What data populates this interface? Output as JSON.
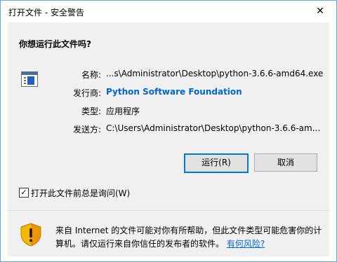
{
  "window": {
    "title": "打开文件 - 安全警告",
    "close_glyph": "✕"
  },
  "dialog": {
    "question": "你想运行此文件吗?",
    "file_icon": "exe-file-icon",
    "fields": [
      {
        "label": "名称:",
        "value": "...s\\Administrator\\Desktop\\python-3.6.6-amd64.exe"
      },
      {
        "label": "发行商:",
        "value": "Python Software Foundation"
      },
      {
        "label": "类型:",
        "value": "应用程序"
      },
      {
        "label": "发送方:",
        "value": "C:\\Users\\Administrator\\Desktop\\python-3.6.6-am..."
      }
    ],
    "run_button": "运行(R)",
    "cancel_button": "取消",
    "always_ask_checkbox": {
      "label": "打开此文件前总是询问(W)",
      "checked": true,
      "glyph": "✓"
    }
  },
  "footer": {
    "icon": "warning-shield-icon",
    "warning_text": "来自 Internet 的文件可能对你有所帮助，但此文件类型可能危害你的计算机。请仅运行来自你信任的发布者的软件。",
    "risk_link": "有何风险?"
  },
  "colors": {
    "accent": "#0078d7",
    "link": "#0066cc",
    "panel_bg": "#f0f0f0",
    "shield_yellow": "#f5b800",
    "shield_orange": "#e87800"
  }
}
